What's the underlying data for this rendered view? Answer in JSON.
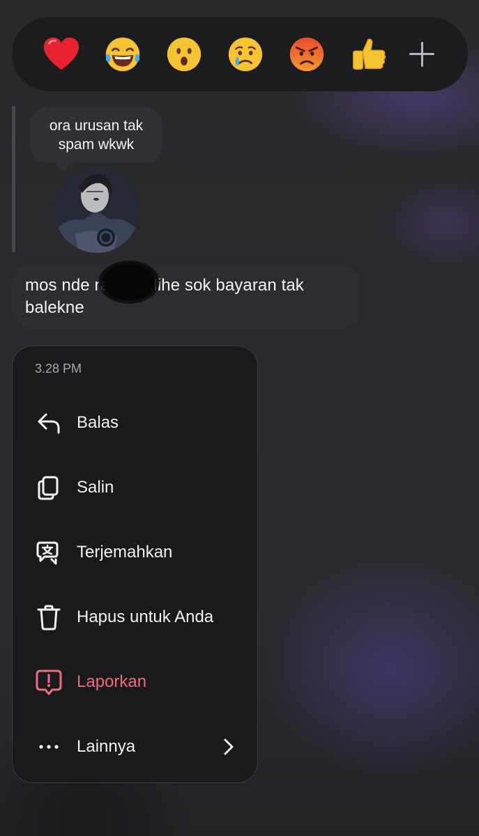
{
  "reactions": [
    {
      "name": "heart",
      "glyph": "❤️"
    },
    {
      "name": "laughing-with-tears",
      "glyph": "😂"
    },
    {
      "name": "surprised",
      "glyph": "😮"
    },
    {
      "name": "crying",
      "glyph": "😢"
    },
    {
      "name": "angry",
      "glyph": "😡"
    },
    {
      "name": "thumbs-up",
      "glyph": "👍"
    }
  ],
  "add_reaction_icon": "plus-icon",
  "note": {
    "text": "ora urusan tak spam wkwk"
  },
  "message": {
    "text": "mos nde      ra tak silihe sok bayaran tak balekne"
  },
  "menu": {
    "time": "3.28 PM",
    "items": [
      {
        "label": "Balas",
        "icon": "reply-icon"
      },
      {
        "label": "Salin",
        "icon": "copy-icon"
      },
      {
        "label": "Terjemahkan",
        "icon": "translate-icon"
      },
      {
        "label": "Hapus untuk Anda",
        "icon": "trash-icon"
      },
      {
        "label": "Laporkan",
        "icon": "report-icon",
        "color": "#ed6b7f"
      },
      {
        "label": "Lainnya",
        "icon": "more-icon"
      }
    ]
  },
  "colors": {
    "danger": "#ed6b7f",
    "menu_bg": "#1a1a1d",
    "bubble_bg": "#2c2d31"
  }
}
